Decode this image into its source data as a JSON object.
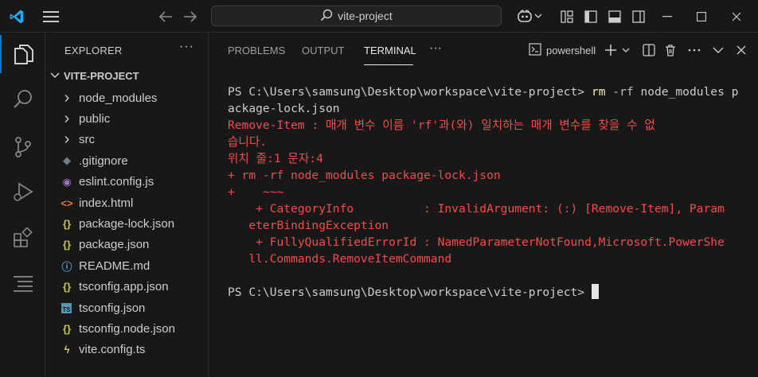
{
  "titlebar": {
    "search_text": "vite-project"
  },
  "explorer": {
    "title": "EXPLORER",
    "more": "···",
    "folder": "VITE-PROJECT",
    "items": [
      {
        "label": "node_modules",
        "icon": "chevron-right-icon",
        "glyph": "›",
        "color": "#cccccc"
      },
      {
        "label": "public",
        "icon": "chevron-right-icon",
        "glyph": "›",
        "color": "#cccccc"
      },
      {
        "label": "src",
        "icon": "chevron-right-icon",
        "glyph": "›",
        "color": "#cccccc"
      },
      {
        "label": ".gitignore",
        "icon": "git-icon",
        "glyph": "◆",
        "color": "#6d8086"
      },
      {
        "label": "eslint.config.js",
        "icon": "eslint-icon",
        "glyph": "◉",
        "color": "#a074c4"
      },
      {
        "label": "index.html",
        "icon": "html-icon",
        "glyph": "<>",
        "color": "#e37933"
      },
      {
        "label": "package-lock.json",
        "icon": "json-icon",
        "glyph": "{}",
        "color": "#cbcb41"
      },
      {
        "label": "package.json",
        "icon": "json-icon",
        "glyph": "{}",
        "color": "#cbcb41"
      },
      {
        "label": "README.md",
        "icon": "info-icon",
        "glyph": "ⓘ",
        "color": "#519aba"
      },
      {
        "label": "tsconfig.app.json",
        "icon": "json-icon",
        "glyph": "{}",
        "color": "#cbcb41"
      },
      {
        "label": "tsconfig.json",
        "icon": "typescript-icon",
        "glyph": "TS",
        "color": "#519aba"
      },
      {
        "label": "tsconfig.node.json",
        "icon": "json-icon",
        "glyph": "{}",
        "color": "#cbcb41"
      },
      {
        "label": "vite.config.ts",
        "icon": "vite-icon",
        "glyph": "ϟ",
        "color": "#cbcb41"
      }
    ]
  },
  "panel": {
    "tabs": [
      "PROBLEMS",
      "OUTPUT",
      "TERMINAL"
    ],
    "active_tab": "TERMINAL",
    "more": "···",
    "shell_label": "powershell"
  },
  "terminal": {
    "prompt": "PS C:\\Users\\samsung\\Desktop\\workspace\\vite-project>",
    "cmd_name": "rm",
    "cmd_flag": "-rf",
    "cmd_args_1": "node_modules p",
    "cmd_args_2": "ackage-lock.json",
    "err1_a": "Remove-Item : 매개 변수 이름 'rf'과(와) 일치하는 매개 변수를 찾을 수 없",
    "err1_b": "습니다.",
    "err2": "위치 줄:1 문자:4",
    "err3": "+ rm -rf node_modules package-lock.json",
    "err4": "+    ~~~",
    "err5_a": "    + CategoryInfo          : InvalidArgument: (:) [Remove-Item], Param",
    "err5_b": "   eterBindingException",
    "err6_a": "    + FullyQualifiedErrorId : NamedParameterNotFound,Microsoft.PowerShe",
    "err6_b": "   ll.Commands.RemoveItemCommand",
    "prompt2": "PS C:\\Users\\samsung\\Desktop\\workspace\\vite-project>"
  },
  "colors": {
    "accent": "#0078d4",
    "error": "#f14c4c",
    "command": "#f1f1a8",
    "vscode_logo": "#23a9f2"
  }
}
